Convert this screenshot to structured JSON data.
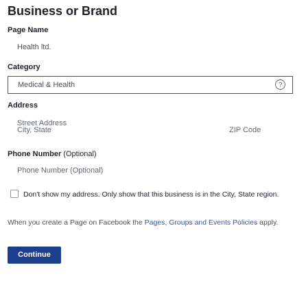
{
  "form": {
    "title": "Business or Brand",
    "page_name": {
      "label": "Page Name",
      "value": "Health ltd."
    },
    "category": {
      "label": "Category",
      "value": "Medical & Health",
      "help_icon": "question-circle-icon"
    },
    "address": {
      "label": "Address",
      "street_placeholder": "Street Address",
      "city_placeholder": "City, State",
      "zip_placeholder": "ZIP Code"
    },
    "phone": {
      "label_main": "Phone Number",
      "label_optional": "(Optional)",
      "placeholder": "Phone Number (Optional)"
    },
    "hide_address": {
      "label": "Don't show my address. Only show that this business is in the City, State region.",
      "checked": false
    },
    "policy": {
      "prefix": "When you create a Page on Facebook the",
      "link_text": "Pages, Groups and Events Policies",
      "suffix": "apply."
    },
    "continue_label": "Continue"
  },
  "colors": {
    "button_bg": "#1b3f8b",
    "link": "#365899",
    "text": "#1d2129",
    "muted": "#606770"
  }
}
